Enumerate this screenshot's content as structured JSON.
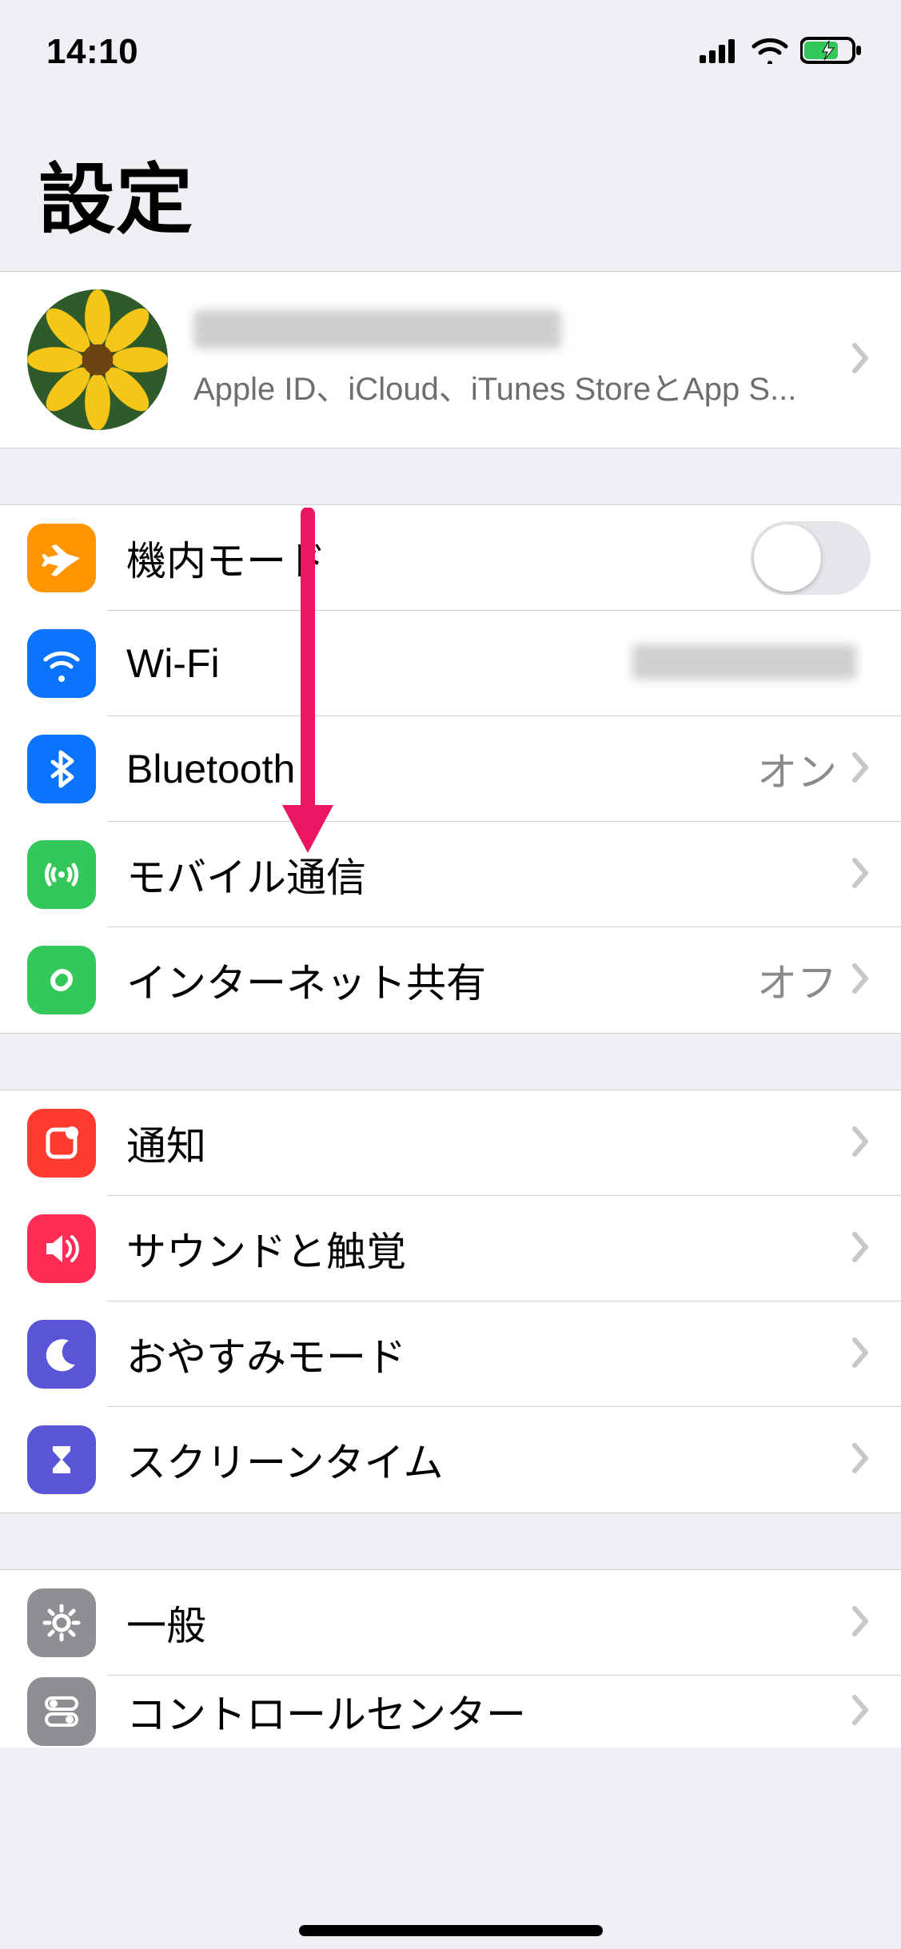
{
  "status": {
    "time": "14:10"
  },
  "title": "設定",
  "profile": {
    "subtitle": "Apple ID、iCloud、iTunes StoreとApp S..."
  },
  "rows": {
    "airplane": {
      "label": "機内モード",
      "toggle": false
    },
    "wifi": {
      "label": "Wi-Fi"
    },
    "bluetooth": {
      "label": "Bluetooth",
      "value": "オン"
    },
    "cellular": {
      "label": "モバイル通信"
    },
    "hotspot": {
      "label": "インターネット共有",
      "value": "オフ"
    },
    "notifications": {
      "label": "通知"
    },
    "sounds": {
      "label": "サウンドと触覚"
    },
    "dnd": {
      "label": "おやすみモード"
    },
    "screentime": {
      "label": "スクリーンタイム"
    },
    "general": {
      "label": "一般"
    },
    "controlcenter": {
      "label": "コントロールセンター"
    }
  },
  "colors": {
    "airplane": "#ff9500",
    "wifi": "#0b74ff",
    "bluetooth": "#0b74ff",
    "cellular": "#34c759",
    "hotspot": "#34c759",
    "notifications": "#ff3b30",
    "sounds": "#ff2d55",
    "dnd": "#5856d6",
    "screentime": "#5856d6",
    "general": "#8e8e93",
    "controlcenter": "#8e8e93",
    "arrow": "#ec1561"
  }
}
